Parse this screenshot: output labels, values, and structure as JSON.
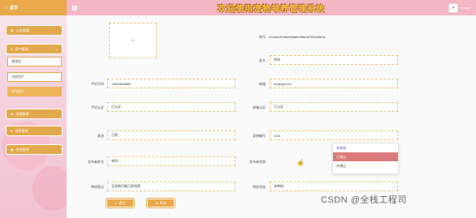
{
  "sidebar": {
    "brand": "首页",
    "menus": [
      "公告管理",
      "用户管理",
      "宠物管理",
      "领养管理",
      "信息管理"
    ],
    "sub_items": [
      "管理员",
      "注册用户",
      "发布用户"
    ]
  },
  "header": {
    "title": "欢迎使用宠物领养管理系统",
    "user": "admin"
  },
  "form": {
    "account": {
      "label": "账号",
      "value": "e1badc394fbe65abbe56e5578394563e"
    },
    "name": {
      "label": "姓名",
      "value": "李四"
    },
    "phone": {
      "label": "手机号码",
      "value": "13823888882"
    },
    "email": {
      "label": "邮箱",
      "value": "lisi@qq.com"
    },
    "phone_verify": {
      "label": "手机认证",
      "value": "已认证"
    },
    "email_verify": {
      "label": "邮箱认证",
      "value": "已认证"
    },
    "status": {
      "label": "状态",
      "value": "正常"
    },
    "pet_id": {
      "label": "宠物编号",
      "value": "1001"
    },
    "publisher_name": {
      "label": "发布者姓名",
      "value": "李四"
    },
    "publisher_status": {
      "label": "发布者状态"
    },
    "review_comment": {
      "label": "审核意见",
      "value": "无宠物可能已经领养"
    },
    "review_status": {
      "label": "审核状态",
      "value": "未审核"
    }
  },
  "dropdown": {
    "options": [
      "未审核",
      "已通过",
      "未通过"
    ],
    "highlighted_index": 1
  },
  "buttons": {
    "submit": "提交",
    "cancel": "取消"
  },
  "watermark": "CSDN @全栈工程司"
}
